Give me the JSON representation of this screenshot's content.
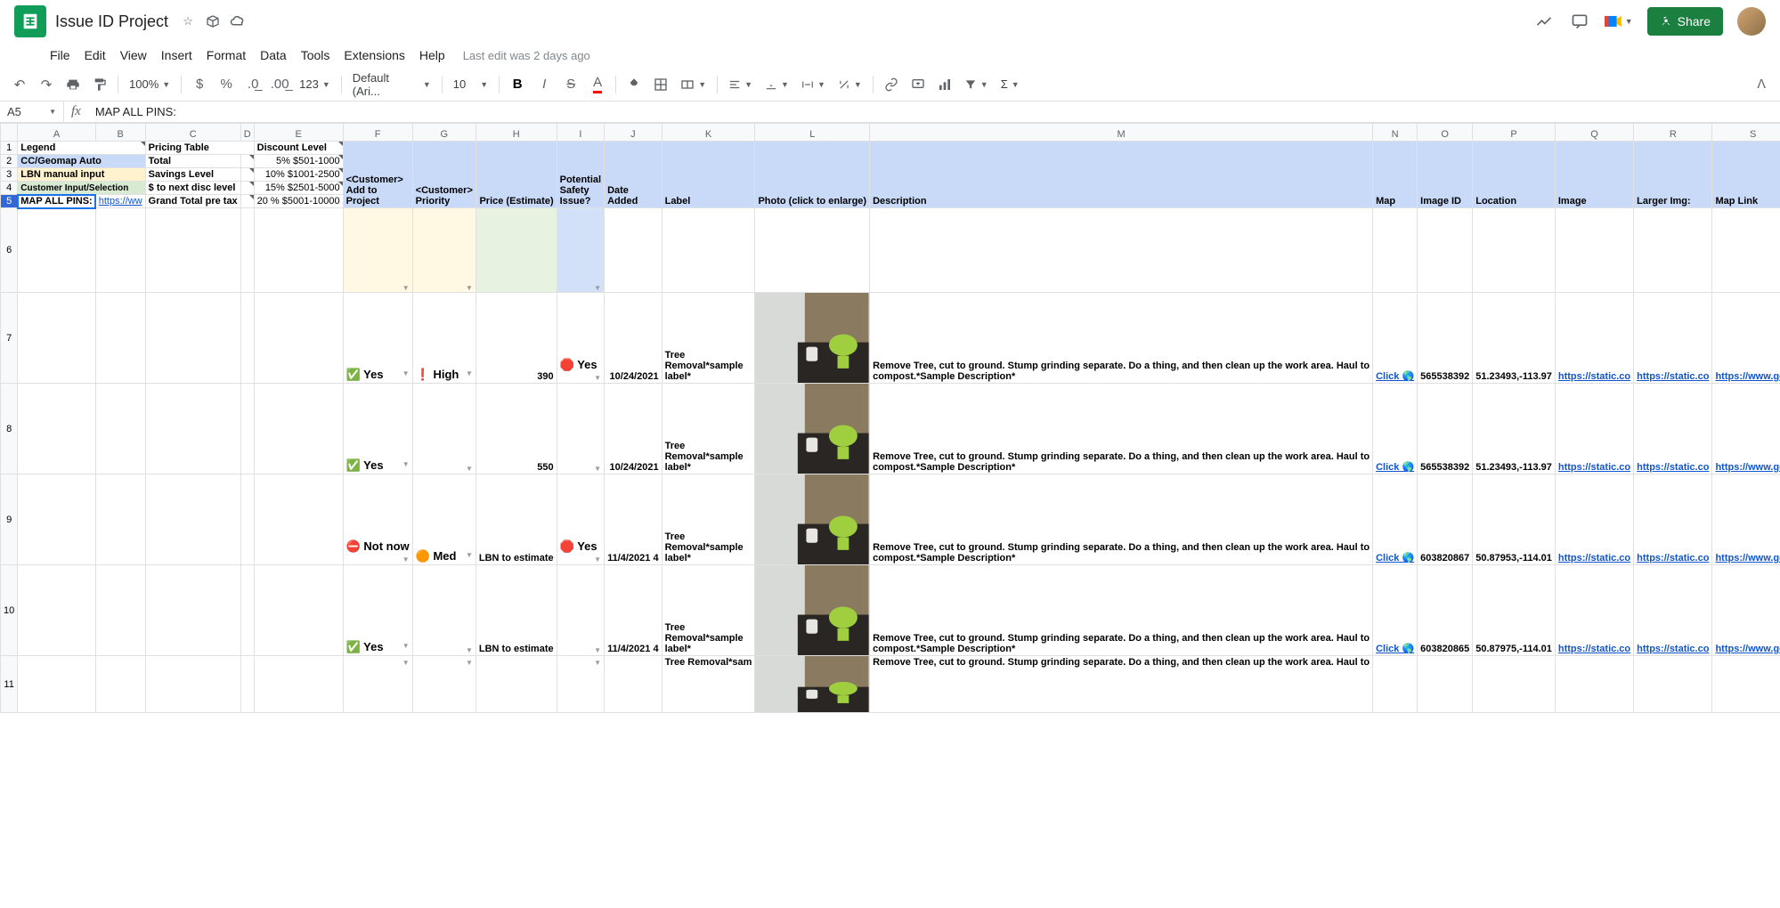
{
  "doc": {
    "title": "Issue ID Project",
    "last_edit": "Last edit was 2 days ago"
  },
  "menu": {
    "file": "File",
    "edit": "Edit",
    "view": "View",
    "insert": "Insert",
    "format": "Format",
    "data": "Data",
    "tools": "Tools",
    "extensions": "Extensions",
    "help": "Help"
  },
  "toolbar": {
    "zoom": "100%",
    "font": "Default (Ari...",
    "size": "10",
    "fmt123": "123"
  },
  "share": "Share",
  "namebox": "A5",
  "formula": "MAP ALL PINS:",
  "cols": [
    "A",
    "B",
    "C",
    "D",
    "E",
    "F",
    "G",
    "H",
    "I",
    "J",
    "K",
    "L",
    "M",
    "N",
    "O",
    "P",
    "Q",
    "R",
    "S"
  ],
  "row1": {
    "a": "Legend",
    "c": "Pricing Table",
    "e": "Discount Level"
  },
  "row2": {
    "a": "CC/Geomap Auto",
    "c": "Total",
    "e": "5% $501-1000"
  },
  "row3": {
    "a": "LBN manual input",
    "c": "Savings Level",
    "e": "10% $1001-2500"
  },
  "row4": {
    "a": "Customer Input/Selection",
    "c": "$ to next disc level",
    "e": "15% $2501-5000"
  },
  "row5": {
    "a": "MAP ALL PINS:",
    "b": "https://ww",
    "c": "Grand Total pre tax",
    "e": "20 % $5001-10000",
    "f": "<Customer> Add to Project",
    "g": "<Customer> Priority",
    "h": "Price (Estimate)",
    "i": "Potential Safety Issue?",
    "j": "Date Added",
    "k": "Label",
    "l": "Photo (click to enlarge)",
    "m": "Description",
    "n": "Map",
    "o": "Image ID",
    "p": "Location",
    "q": "Image",
    "r": "Larger Img:",
    "s": "Map Link"
  },
  "rows": [
    {
      "num": 7,
      "f": "✅  Yes",
      "g": "❗ High",
      "h": "390",
      "i": "🛑 Yes",
      "j": "10/24/2021",
      "k": "Tree Removal*sample label*",
      "m": "Remove Tree, cut to ground. Stump grinding separate. Do a thing, and then clean up the work area. Haul to compost.*Sample Description*",
      "n": "Click 🌎",
      "o": "565538392",
      "p": "51.23493,-113.97",
      "q": "https://static.co",
      "r": "https://static.co",
      "s": "https://www.geo"
    },
    {
      "num": 8,
      "f": "✅  Yes",
      "g": "",
      "h": "550",
      "i": "",
      "j": "10/24/2021",
      "k": "Tree Removal*sample label*",
      "m": "Remove Tree, cut to ground. Stump grinding separate. Do a thing, and then clean up the work area. Haul to compost.*Sample Description*",
      "n": "Click 🌎",
      "o": "565538392",
      "p": "51.23493,-113.97",
      "q": "https://static.co",
      "r": "https://static.co",
      "s": "https://www.geo"
    },
    {
      "num": 9,
      "f": "⛔  Not now",
      "g": "🟠 Med",
      "h": "LBN to estimate",
      "i": "🛑 Yes",
      "j": "11/4/2021",
      "j2": "4",
      "k": "Tree Removal*sample label*",
      "m": "Remove Tree, cut to ground. Stump grinding separate. Do a thing, and then clean up the work area. Haul to compost.*Sample Description*",
      "n": "Click 🌎",
      "o": "603820867",
      "p": "50.87953,-114.01",
      "q": "https://static.co",
      "r": "https://static.co",
      "s": "https://www.geo"
    },
    {
      "num": 10,
      "f": "✅  Yes",
      "g": "",
      "h": "LBN to estimate",
      "i": "",
      "j": "11/4/2021",
      "j2": "4",
      "k": "Tree Removal*sample label*",
      "m": "Remove Tree, cut to ground. Stump grinding separate. Do a thing, and then clean up the work area. Haul to compost.*Sample Description*",
      "n": "Click 🌎",
      "o": "603820865",
      "p": "50.87975,-114.01",
      "q": "https://static.co",
      "r": "https://static.co",
      "s": "https://www.geo"
    },
    {
      "num": 11,
      "f": "",
      "g": "",
      "h": "",
      "i": "",
      "j": "",
      "j2": "",
      "k": "Tree Removal*sam",
      "m": "Remove Tree, cut to ground. Stump grinding separate. Do a thing, and then clean up the work area. Haul to",
      "n": "",
      "o": "",
      "p": "",
      "q": "",
      "r": "",
      "s": ""
    }
  ]
}
